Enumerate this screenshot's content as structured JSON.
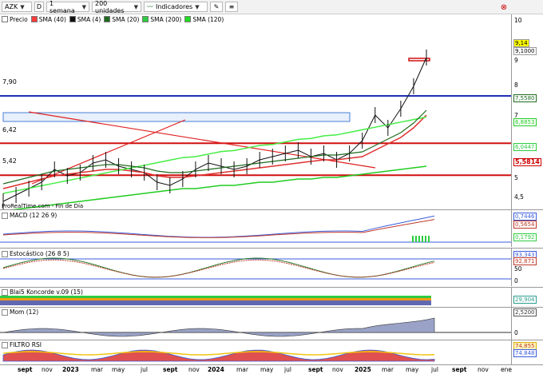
{
  "toolbar": {
    "ticker": "AZK",
    "d_label": "D",
    "period": "1 semana",
    "units": "200 unidades",
    "indicators": "Indicadores"
  },
  "legend": [
    {
      "label": "Precio",
      "color": "#ffffff"
    },
    {
      "label": "SMA (40)",
      "color": "#ff3b3b"
    },
    {
      "label": "SMA (4)",
      "color": "#111111"
    },
    {
      "label": "SMA (20)",
      "color": "#1f6b1f"
    },
    {
      "label": "SMA (200)",
      "color": "#2ecc40"
    },
    {
      "label": "SMA (120)",
      "color": "#22dd22"
    }
  ],
  "price_pane": {
    "source_text": "ProRealTime.com - Fin de Día",
    "line_labels": [
      "7,90",
      "6,42",
      "5,42"
    ],
    "axis_ticks": [
      "10",
      "9",
      "8",
      "7",
      "6",
      "5",
      "4,5"
    ],
    "tags": [
      {
        "text": "9,14",
        "color": "#000000",
        "bg": "#ffff00"
      },
      {
        "text": "9,1000",
        "color": "#000000",
        "bg": "#ffffff"
      },
      {
        "text": "7,5580",
        "color": "#1f6b1f",
        "bg": "#ffffff"
      },
      {
        "text": "6,8853",
        "color": "#22cc22",
        "bg": "#ffffff"
      },
      {
        "text": "6,0447",
        "color": "#2ecc40",
        "bg": "#ffffff"
      },
      {
        "text": "5,5814",
        "color": "#cc0000",
        "bg": "#ffffff"
      }
    ]
  },
  "macd": {
    "label": "MACD (12 26 9)",
    "tags": [
      "0,7446",
      "0,5654",
      "0,1792"
    ]
  },
  "stoch": {
    "label": "Estocástico (26 8 5)",
    "tags": [
      "93,343",
      "92,871"
    ],
    "ticks": [
      "50",
      "0"
    ]
  },
  "blai5": {
    "label": "Blai5 Koncorde v.09 (15)",
    "tags": [
      "29,904"
    ]
  },
  "mom": {
    "label": "Mom (12)",
    "tags": [
      "2,5200"
    ],
    "ticks": [
      "0"
    ]
  },
  "rsi": {
    "label": "FILTRO RSI",
    "tags": [
      "74,855",
      "74,848"
    ]
  },
  "x_axis": [
    "sept",
    "nov",
    "2023",
    "mar",
    "may",
    "jul",
    "sept",
    "nov",
    "2024",
    "mar",
    "may",
    "jul",
    "sept",
    "nov",
    "2025",
    "mar",
    "may",
    "jul",
    "sept",
    "nov",
    "ene"
  ],
  "chart_data": {
    "type": "line",
    "title": "AZK",
    "series": [
      {
        "name": "Precio",
        "values": [
          4.6,
          4.8,
          5.0,
          5.2,
          5.6,
          5.4,
          5.5,
          5.8,
          5.9,
          5.7,
          5.6,
          5.5,
          5.2,
          5.1,
          5.3,
          5.6,
          5.8,
          5.7,
          5.6,
          5.7,
          5.9,
          6.0,
          6.1,
          6.2,
          6.0,
          6.1,
          5.9,
          6.1,
          6.5,
          7.3,
          6.9,
          7.5,
          8.2,
          9.1
        ]
      },
      {
        "name": "SMA (40)",
        "values": [
          5.0,
          5.1,
          5.2,
          5.3,
          5.4,
          5.45,
          5.5,
          5.55,
          5.6,
          5.6,
          5.55,
          5.5,
          5.4,
          5.35,
          5.35,
          5.4,
          5.45,
          5.5,
          5.55,
          5.6,
          5.65,
          5.7,
          5.75,
          5.8,
          5.85,
          5.9,
          5.9,
          5.95,
          6.0,
          6.2,
          6.4,
          6.6,
          6.9,
          7.3
        ]
      },
      {
        "name": "SMA (200)",
        "values": [
          4.3,
          4.35,
          4.4,
          4.45,
          4.5,
          4.55,
          4.6,
          4.65,
          4.7,
          4.75,
          4.8,
          4.85,
          4.9,
          4.95,
          5.0,
          5.0,
          5.05,
          5.1,
          5.1,
          5.15,
          5.2,
          5.2,
          5.25,
          5.3,
          5.3,
          5.35,
          5.35,
          5.4,
          5.45,
          5.5,
          5.55,
          5.6,
          5.65,
          5.7
        ]
      }
    ],
    "hlines": [
      7.9,
      6.42,
      5.42
    ],
    "ylim": [
      4.5,
      10
    ]
  }
}
